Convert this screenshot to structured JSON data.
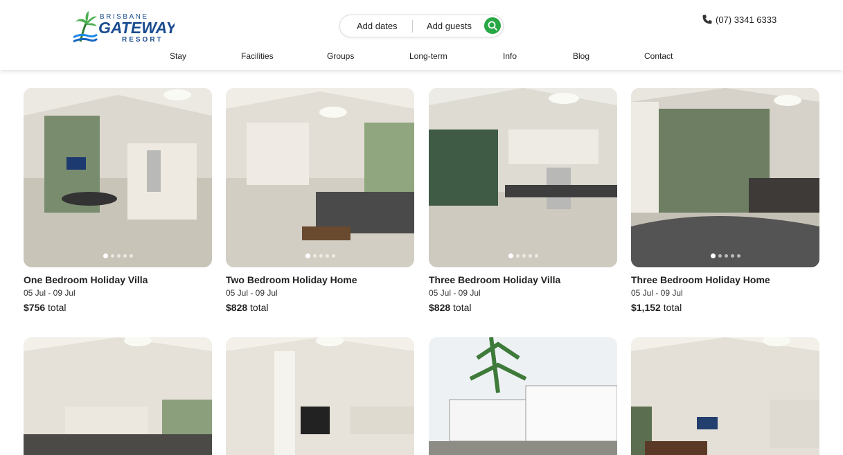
{
  "brand": {
    "logo_line1": "BRISBANE",
    "logo_line2": "GATEWAY",
    "logo_line3": "RESORT",
    "accent_color": "#27a844",
    "logo_color": "#1a4d8f"
  },
  "search": {
    "dates_label": "Add dates",
    "guests_label": "Add guests",
    "search_icon": "search-icon"
  },
  "contact": {
    "phone": "(07) 3341 6333",
    "phone_icon": "phone-icon"
  },
  "nav": {
    "items": [
      {
        "label": "Stay"
      },
      {
        "label": "Facilities"
      },
      {
        "label": "Groups"
      },
      {
        "label": "Long-term"
      },
      {
        "label": "Info"
      },
      {
        "label": "Blog"
      },
      {
        "label": "Contact"
      }
    ]
  },
  "listings": [
    {
      "title": "One Bedroom Holiday Villa",
      "dates": "05 Jul - 09 Jul",
      "price": "$756",
      "price_suffix": "total"
    },
    {
      "title": "Two Bedroom Holiday Home",
      "dates": "05 Jul - 09 Jul",
      "price": "$828",
      "price_suffix": "total"
    },
    {
      "title": "Three Bedroom Holiday Villa",
      "dates": "05 Jul - 09 Jul",
      "price": "$828",
      "price_suffix": "total"
    },
    {
      "title": "Three Bedroom Holiday Home",
      "dates": "05 Jul - 09 Jul",
      "price": "$1,152",
      "price_suffix": "total"
    }
  ]
}
